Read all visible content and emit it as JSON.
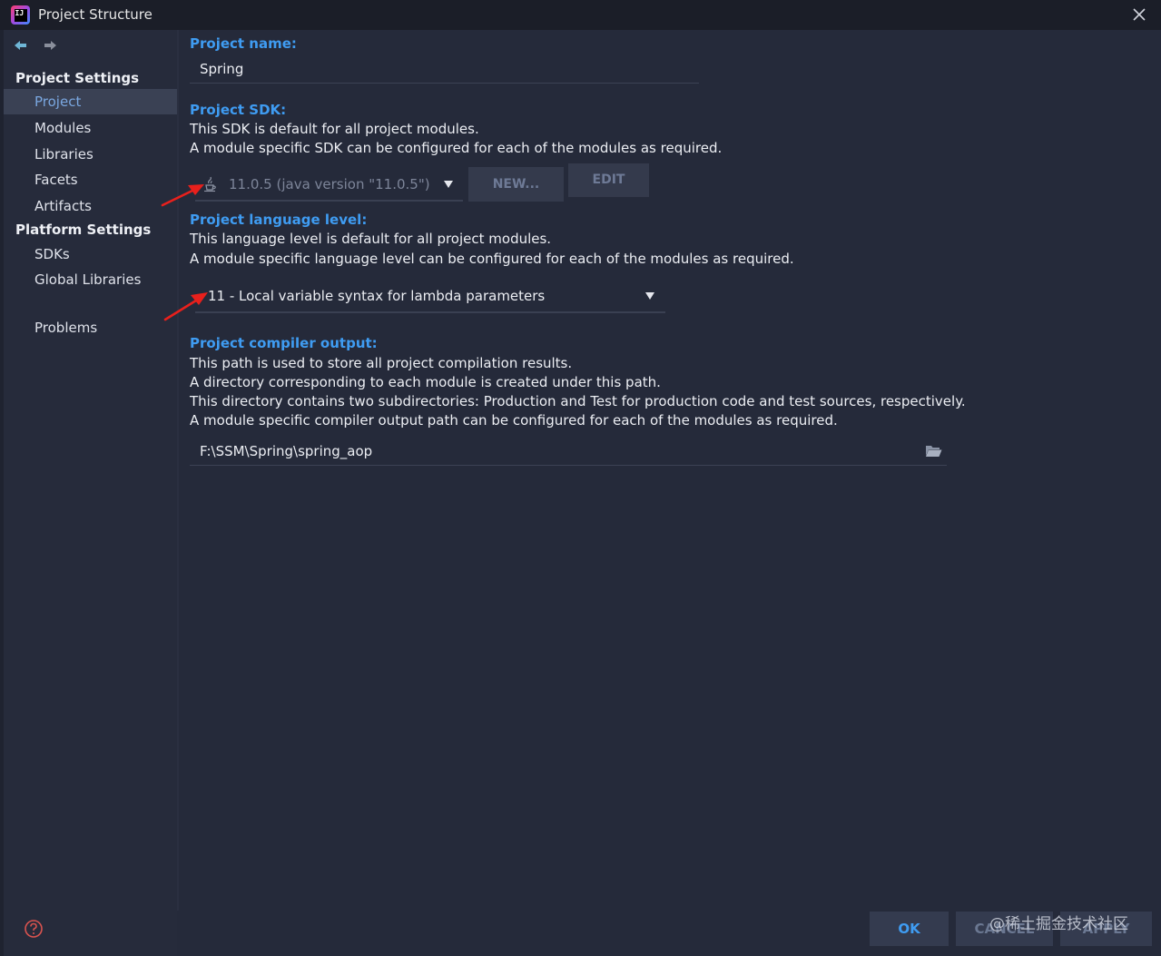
{
  "window": {
    "title": "Project Structure",
    "app_icon_text": "IJ"
  },
  "sidebar": {
    "project_settings_heading": "Project Settings",
    "project_settings_items": [
      "Project",
      "Modules",
      "Libraries",
      "Facets",
      "Artifacts"
    ],
    "platform_settings_heading": "Platform Settings",
    "platform_settings_items": [
      "SDKs",
      "Global Libraries"
    ],
    "problems_label": "Problems",
    "selected_item": "Project"
  },
  "main": {
    "project_name": {
      "label": "Project name:",
      "value": "Spring"
    },
    "project_sdk": {
      "label": "Project SDK:",
      "desc_line1": "This SDK is default for all project modules.",
      "desc_line2": "A module specific SDK can be configured for each of the modules as required.",
      "selected": "11.0.5 (java version \"11.0.5\")",
      "new_button": "NEW...",
      "edit_button": "EDIT"
    },
    "language_level": {
      "label": "Project language level:",
      "desc_line1": "This language level is default for all project modules.",
      "desc_line2": "A module specific language level can be configured for each of the modules as required.",
      "selected": "11 - Local variable syntax for lambda parameters"
    },
    "compiler_output": {
      "label": "Project compiler output:",
      "desc_line1": "This path is used to store all project compilation results.",
      "desc_line2": "A directory corresponding to each module is created under this path.",
      "desc_line3": "This directory contains two subdirectories: Production and Test for production code and test sources, respectively.",
      "desc_line4": "A module specific compiler output path can be configured for each of the modules as required.",
      "path": "F:\\SSM\\Spring\\spring_aop"
    }
  },
  "footer": {
    "ok": "OK",
    "cancel": "CANCEL",
    "apply": "APPLY",
    "watermark": "@稀土掘金技术社区"
  },
  "colors": {
    "background": "#252a3a",
    "accent_label": "#3f9cf2",
    "selected_bg": "#3a4154",
    "annotation_red": "#e8201c"
  }
}
